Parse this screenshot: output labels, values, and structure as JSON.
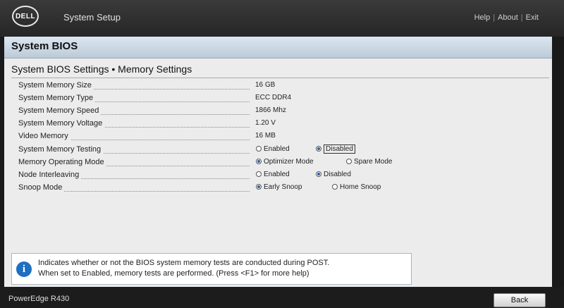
{
  "header": {
    "logo_text": "DELL",
    "title": "System Setup",
    "links": {
      "help": "Help",
      "about": "About",
      "exit": "Exit",
      "separator": "|"
    }
  },
  "band": {
    "title": "System BIOS"
  },
  "section": {
    "title": "System BIOS Settings • Memory Settings"
  },
  "settings": [
    {
      "label": "System Memory Size",
      "value": "16 GB"
    },
    {
      "label": "System Memory Type",
      "value": "ECC DDR4"
    },
    {
      "label": "System Memory Speed",
      "value": "1866 Mhz"
    },
    {
      "label": "System Memory Voltage",
      "value": "1.20 V"
    },
    {
      "label": "Video Memory",
      "value": "16 MB"
    },
    {
      "label": "System Memory Testing",
      "options": [
        "Enabled",
        "Disabled"
      ],
      "selected": "Disabled"
    },
    {
      "label": "Memory Operating Mode",
      "options": [
        "Optimizer Mode",
        "Spare Mode"
      ],
      "selected": "Optimizer Mode"
    },
    {
      "label": "Node Interleaving",
      "options": [
        "Enabled",
        "Disabled"
      ],
      "selected": "Disabled"
    },
    {
      "label": "Snoop Mode",
      "options": [
        "Early Snoop",
        "Home Snoop"
      ],
      "selected": "Early Snoop"
    }
  ],
  "help": {
    "icon": "info-icon",
    "line1": "Indicates whether or not the BIOS system memory tests are conducted during POST.",
    "line2": "When set to Enabled, memory tests are performed. (Press <F1> for more help)"
  },
  "footer": {
    "model": "PowerEdge R430",
    "back_label": "Back"
  },
  "colors": {
    "accent": "#2b5fa8",
    "band": "#c8d5e2",
    "info": "#1f6fc0"
  }
}
